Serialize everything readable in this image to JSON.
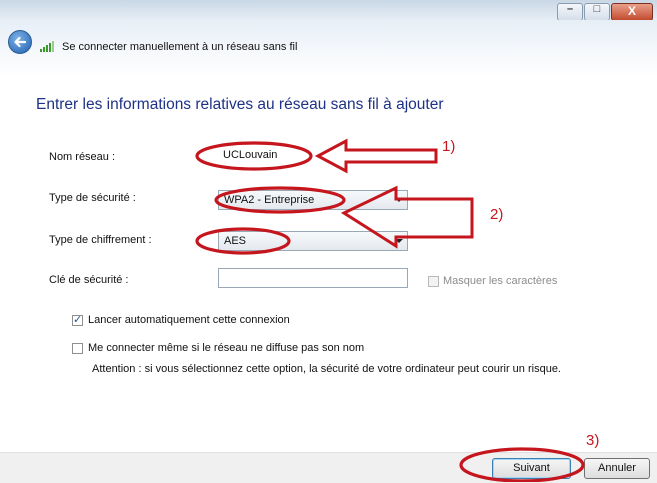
{
  "window": {
    "title": "Se connecter manuellement à un réseau sans fil",
    "controls": {
      "minimize": "–",
      "maximize": "□",
      "close": "X"
    }
  },
  "heading": "Entrer les informations relatives au réseau sans fil à ajouter",
  "form": {
    "network_name": {
      "label": "Nom réseau :",
      "value": "UCLouvain"
    },
    "security_type": {
      "label": "Type de sécurité :",
      "value": "WPA2 - Entreprise"
    },
    "encryption_type": {
      "label": "Type de chiffrement :",
      "value": "AES"
    },
    "security_key": {
      "label": "Clé de sécurité :",
      "value": "",
      "hide_chars_label": "Masquer les caractères",
      "hide_chars_checked": false
    }
  },
  "options": {
    "auto_connect": {
      "label": "Lancer automatiquement cette connexion",
      "checked": true
    },
    "connect_hidden": {
      "label": "Me connecter même si le réseau ne diffuse pas son nom",
      "checked": false
    },
    "warning": "Attention : si vous sélectionnez cette option, la sécurité de votre ordinateur peut courir un risque."
  },
  "buttons": {
    "next": "Suivant",
    "cancel": "Annuler"
  },
  "annotations": {
    "step1": "1)",
    "step2": "2)",
    "step3": "3)",
    "color": "#c5161d"
  }
}
